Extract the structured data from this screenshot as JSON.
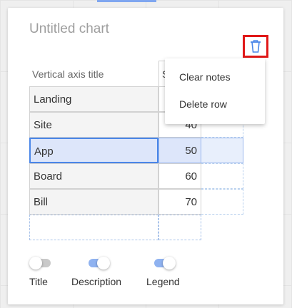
{
  "chart": {
    "title": "Untitled chart"
  },
  "table": {
    "header_col1": "Vertical axis title",
    "header_col2": "S",
    "rows": [
      {
        "label": "Landing",
        "value": ""
      },
      {
        "label": "Site",
        "value": "40"
      },
      {
        "label": "App",
        "value": "50"
      },
      {
        "label": "Board",
        "value": "60"
      },
      {
        "label": "Bill",
        "value": "70"
      }
    ],
    "selected_row": "App"
  },
  "context_menu": {
    "items": [
      {
        "label": "Clear notes"
      },
      {
        "label": "Delete row"
      }
    ]
  },
  "toggles": [
    {
      "label": "Title",
      "state": "off"
    },
    {
      "label": "Description",
      "state": "on"
    },
    {
      "label": "Legend",
      "state": "on"
    }
  ],
  "icons": {
    "delete": "trash-icon"
  },
  "colors": {
    "highlight_border": "#e01818",
    "selection": "#4a86e8",
    "toggle_on": "#8fb2f0"
  }
}
